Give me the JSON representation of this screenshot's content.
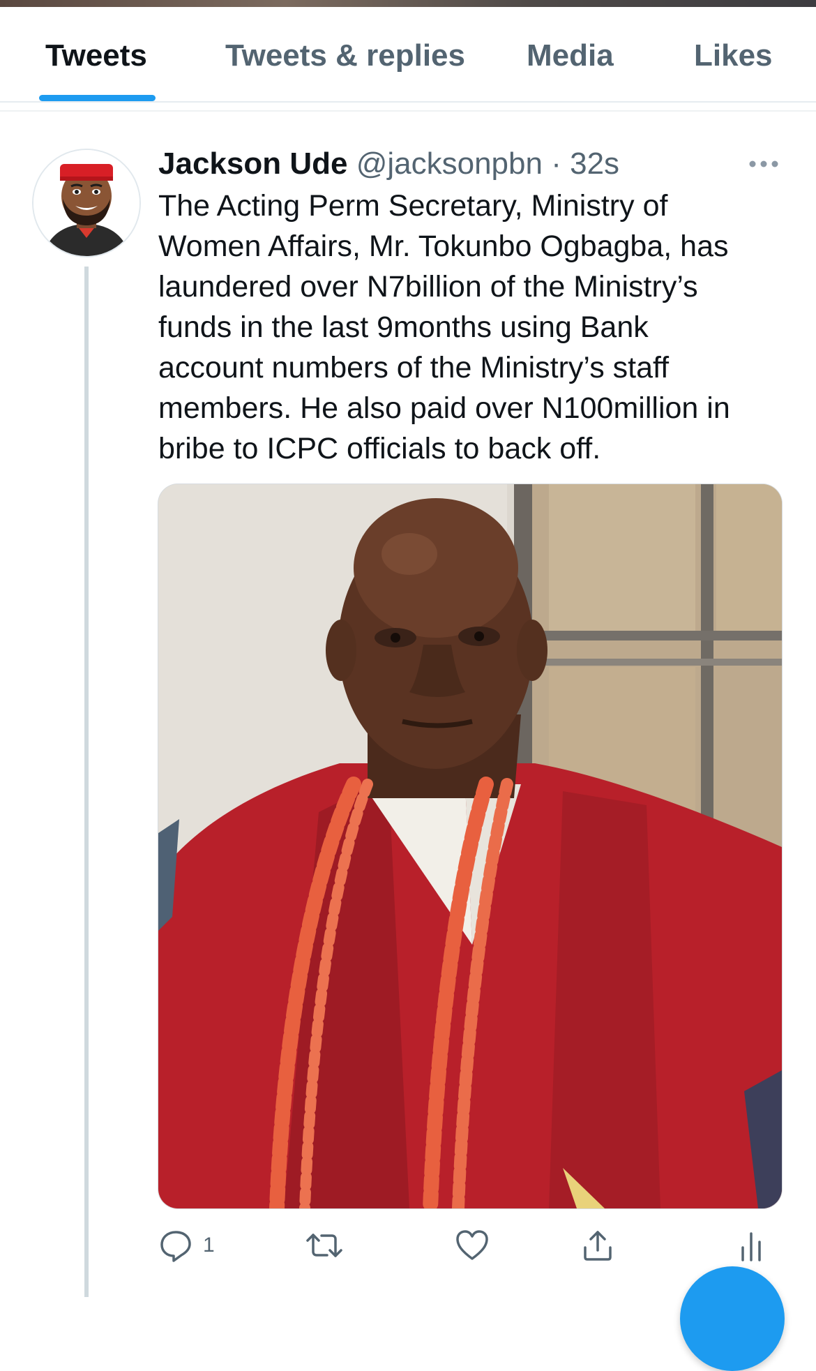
{
  "tabs": [
    {
      "label": "Tweets",
      "active": true
    },
    {
      "label": "Tweets & replies",
      "active": false
    },
    {
      "label": "Media",
      "active": false
    },
    {
      "label": "Likes",
      "active": false
    }
  ],
  "tweet": {
    "author_name": "Jackson Ude",
    "handle": "@jacksonpbn",
    "separator": "·",
    "time": "32s",
    "text": "The Acting Perm Secretary, Ministry of\nWomen Affairs, Mr. Tokunbo Ogbagba, has\nlaundered over N7billion of the Ministry’s\nfunds in the last 9months using Bank\naccount numbers of the Ministry’s staff\nmembers. He also paid over N100million in\nbribe to ICPC officials to back off.",
    "reply_count": "1",
    "avatar_icon": "cartoon-avatar",
    "media_icon": "photo-of-man-in-red-attire"
  },
  "actions": {
    "reply_icon": "reply-icon",
    "retweet_icon": "retweet-icon",
    "like_icon": "heart-icon",
    "share_icon": "share-icon",
    "analytics_icon": "analytics-icon"
  },
  "colors": {
    "accent": "#1d9bf0",
    "primary_text": "#0f1419",
    "secondary_text": "#536471",
    "thread_line": "#cfd9de"
  }
}
